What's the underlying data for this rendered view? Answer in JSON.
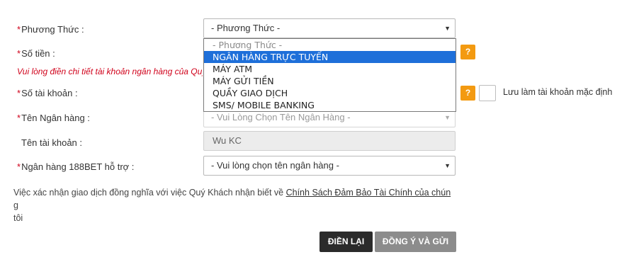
{
  "form": {
    "method": {
      "label": "Phương Thức :",
      "required_mark": "*",
      "selected": "- Phương Thức -"
    },
    "amount": {
      "label": "Số tiền :",
      "required_mark": "*"
    },
    "bank_detail_note": "Vui lòng điền chi tiết tài khoản ngân hàng của Quý Khách",
    "account_number": {
      "label": "Số tài khoản :",
      "required_mark": "*"
    },
    "bank_name": {
      "label": "Tên Ngân hàng :",
      "required_mark": "*",
      "selected": "- Vui Lòng Chọn Tên Ngân Hàng -"
    },
    "account_name": {
      "label": "Tên tài khoản :",
      "value": "Wu KC"
    },
    "supported_bank": {
      "label": "Ngân hàng 188BET hỗ trợ :",
      "required_mark": "*",
      "selected": "- Vui lòng chọn tên ngân hàng -"
    },
    "help_symbol": "?",
    "remember_label": "Lưu làm tài khoản mặc định"
  },
  "dropdown": {
    "options": [
      "- Phương Thức -",
      "NGÂN HÀNG TRỰC TUYẾN",
      "MÁY ATM",
      "MÁY GỬI TIỀN",
      "QUẦY GIAO DỊCH",
      "SMS/ MOBILE BANKING"
    ],
    "highlighted_index": 1
  },
  "terms": {
    "text": "Việc xác nhận giao dịch đồng nghĩa với việc Quý Khách nhận biết về ",
    "link": "Chính Sách Đảm Bảo Tài Chính của chún",
    "tail1": "g",
    "tail2": "tôi"
  },
  "buttons": {
    "reset": "ĐIỀN LẠI",
    "submit": "ĐỒNG Ý VÀ GỬI"
  },
  "colors": {
    "required": "#d0021b",
    "help_badge": "#f39a11",
    "highlight": "#1e6fd9",
    "reset_button": "#2b2b2b",
    "submit_button": "#8c8c8c"
  }
}
